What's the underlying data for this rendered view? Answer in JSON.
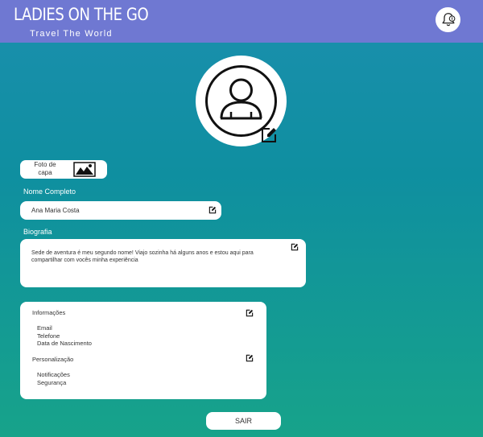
{
  "header": {
    "title": "LADIES ON THE GO",
    "subtitle": "Travel The World",
    "notification_icon": "bell-alert-icon"
  },
  "profile": {
    "avatar_icon": "user-avatar-icon",
    "avatar_edit_icon": "edit-icon"
  },
  "cover": {
    "label": "Foto de capa",
    "icon": "image-icon"
  },
  "name_field": {
    "label": "Nome Completo",
    "value": "Ana Maria Costa",
    "edit_icon": "edit-icon"
  },
  "bio_field": {
    "label": "Biografia",
    "value": "Sede de aventura é meu segundo nome! Viajo sozinha há alguns anos e estou aqui para compartilhar com vocês minha experiência",
    "edit_icon": "edit-icon"
  },
  "settings": {
    "info": {
      "title": "Informações",
      "items": [
        "Email",
        "Telefone",
        "Data de Nascimento"
      ]
    },
    "personalization": {
      "title": "Personalização",
      "items": [
        "Notificações",
        "Segurança"
      ]
    }
  },
  "exit_button": {
    "label": "SAIR"
  }
}
